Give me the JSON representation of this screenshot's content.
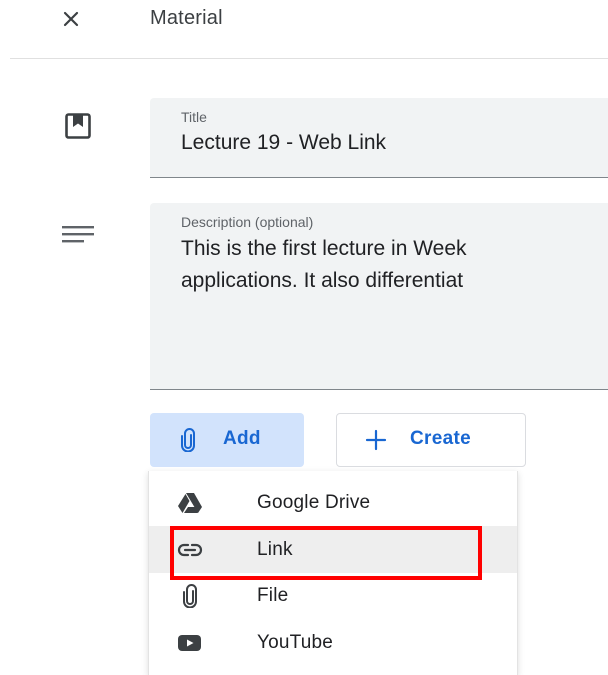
{
  "header": {
    "title": "Material"
  },
  "title_field": {
    "label": "Title",
    "value": "Lecture 19 - Web Link"
  },
  "description_field": {
    "label": "Description (optional)",
    "line1": "This is the first lecture in Week",
    "line2": "applications. It also differentiat"
  },
  "buttons": {
    "add_label": "Add",
    "create_label": "Create"
  },
  "add_menu": {
    "items": [
      {
        "label": "Google Drive",
        "icon": "google-drive-icon"
      },
      {
        "label": "Link",
        "icon": "link-icon"
      },
      {
        "label": "File",
        "icon": "paperclip-icon"
      },
      {
        "label": "YouTube",
        "icon": "youtube-icon"
      }
    ],
    "highlighted": "Link"
  },
  "colors": {
    "accent": "#1967d2",
    "add_button_bg": "#d2e3fc",
    "highlight": "#ff0000"
  }
}
